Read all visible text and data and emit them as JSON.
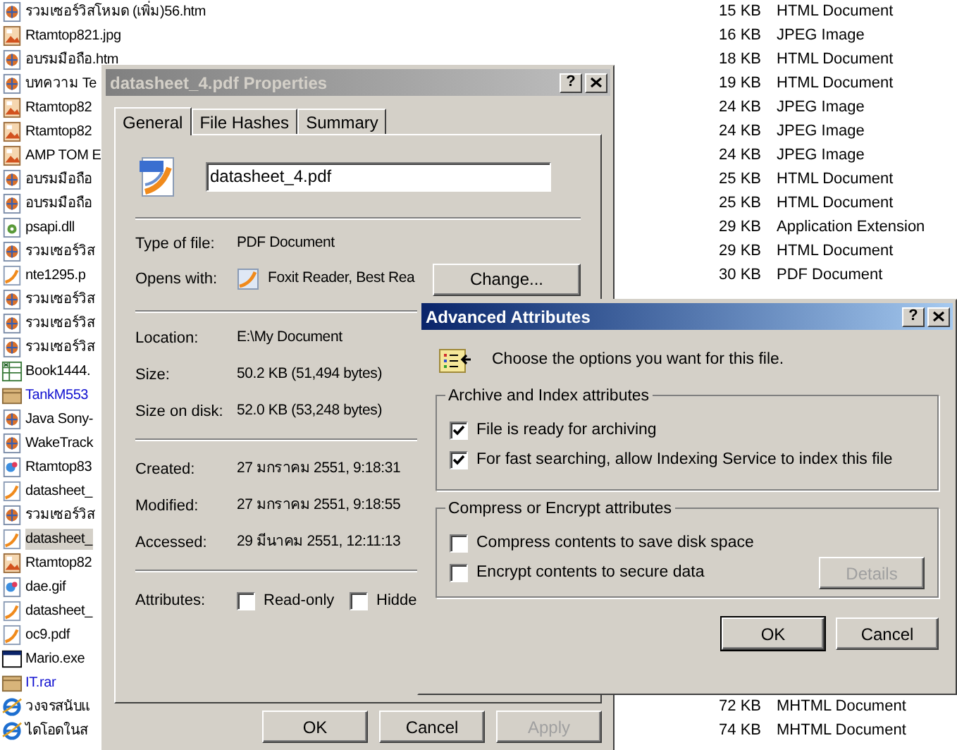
{
  "file_list": {
    "rows": [
      {
        "name": "รวมเซอร์วิสโหมด (เพิ่ม)56.htm",
        "kind": "htm",
        "selected": false,
        "compressed": false,
        "size": "15 KB",
        "type": "HTML Document"
      },
      {
        "name": "Rtamtop821.jpg",
        "kind": "jpg",
        "selected": false,
        "compressed": false,
        "size": "16 KB",
        "type": "JPEG Image"
      },
      {
        "name": "อบรมมือถือ.htm",
        "kind": "htm",
        "selected": false,
        "compressed": false,
        "size": "18 KB",
        "type": "HTML Document"
      },
      {
        "name": "บทความ Te",
        "kind": "htm",
        "selected": false,
        "compressed": false,
        "size": "19 KB",
        "type": "HTML Document"
      },
      {
        "name": "Rtamtop82",
        "kind": "jpg",
        "selected": false,
        "compressed": false,
        "size": "24 KB",
        "type": "JPEG Image"
      },
      {
        "name": "Rtamtop82",
        "kind": "jpg",
        "selected": false,
        "compressed": false,
        "size": "24 KB",
        "type": "JPEG Image"
      },
      {
        "name": "AMP TOM E",
        "kind": "jpg",
        "selected": false,
        "compressed": false,
        "size": "24 KB",
        "type": "JPEG Image"
      },
      {
        "name": "อบรมมือถือ",
        "kind": "htm",
        "selected": false,
        "compressed": false,
        "size": "25 KB",
        "type": "HTML Document"
      },
      {
        "name": "อบรมมือถือ",
        "kind": "htm",
        "selected": false,
        "compressed": false,
        "size": "25 KB",
        "type": "HTML Document"
      },
      {
        "name": "psapi.dll",
        "kind": "dll",
        "selected": false,
        "compressed": false,
        "size": "29 KB",
        "type": "Application Extension"
      },
      {
        "name": "รวมเซอร์วิส",
        "kind": "htm",
        "selected": false,
        "compressed": false,
        "size": "29 KB",
        "type": "HTML Document"
      },
      {
        "name": "nte1295.p",
        "kind": "pdf",
        "selected": false,
        "compressed": false,
        "size": "30 KB",
        "type": "PDF Document"
      },
      {
        "name": "รวมเซอร์วิส",
        "kind": "htm",
        "selected": false,
        "compressed": false
      },
      {
        "name": "รวมเซอร์วิส",
        "kind": "htm",
        "selected": false,
        "compressed": false
      },
      {
        "name": "รวมเซอร์วิส",
        "kind": "htm",
        "selected": false,
        "compressed": false
      },
      {
        "name": "Book1444.",
        "kind": "xls",
        "selected": false,
        "compressed": false
      },
      {
        "name": "TankM553",
        "kind": "rar",
        "selected": false,
        "compressed": true
      },
      {
        "name": "Java Sony-",
        "kind": "htm",
        "selected": false,
        "compressed": false
      },
      {
        "name": "WakeTrack",
        "kind": "htm",
        "selected": false,
        "compressed": false
      },
      {
        "name": "Rtamtop83",
        "kind": "gif",
        "selected": false,
        "compressed": false
      },
      {
        "name": "datasheet_",
        "kind": "pdf",
        "selected": false,
        "compressed": false
      },
      {
        "name": "รวมเซอร์วิส",
        "kind": "htm",
        "selected": false,
        "compressed": false
      },
      {
        "name": "datasheet_",
        "kind": "pdf",
        "selected": true,
        "compressed": false
      },
      {
        "name": "Rtamtop82",
        "kind": "jpg",
        "selected": false,
        "compressed": false
      },
      {
        "name": "dae.gif",
        "kind": "gif",
        "selected": false,
        "compressed": false
      },
      {
        "name": "datasheet_",
        "kind": "pdf",
        "selected": false,
        "compressed": false
      },
      {
        "name": "oc9.pdf",
        "kind": "pdf",
        "selected": false,
        "compressed": false
      },
      {
        "name": "Mario.exe",
        "kind": "exe",
        "selected": false,
        "compressed": false
      },
      {
        "name": "IT.rar",
        "kind": "rar",
        "selected": false,
        "compressed": true
      },
      {
        "name": "วงจรสนับแ",
        "kind": "mht",
        "selected": false,
        "compressed": false,
        "size": "72 KB",
        "type": "MHTML Document"
      },
      {
        "name": "ไดโอดในส",
        "kind": "mht",
        "selected": false,
        "compressed": false,
        "size": "74 KB",
        "type": "MHTML Document"
      }
    ]
  },
  "properties_dialog": {
    "title": "datasheet_4.pdf Properties",
    "active": false,
    "help": "?",
    "tabs": [
      {
        "label": "General",
        "selected": true
      },
      {
        "label": "File Hashes",
        "selected": false
      },
      {
        "label": "Summary",
        "selected": false
      }
    ],
    "file_name": "datasheet_4.pdf",
    "type_of_file": {
      "label": "Type of file:",
      "value": "PDF Document"
    },
    "opens_with": {
      "label": "Opens with:",
      "value": "Foxit Reader, Best Rea",
      "button": "Change..."
    },
    "location": {
      "label": "Location:",
      "value": "E:\\My Document"
    },
    "size": {
      "label": "Size:",
      "value": "50.2 KB (51,494 bytes)"
    },
    "size_on_disk": {
      "label": "Size on disk:",
      "value": "52.0 KB (53,248 bytes)"
    },
    "created": {
      "label": "Created:",
      "value": "27 มกราคม 2551, 9:18:31"
    },
    "modified": {
      "label": "Modified:",
      "value": "27 มกราคม 2551, 9:18:55"
    },
    "accessed": {
      "label": "Accessed:",
      "value": "29 มีนาคม 2551, 12:11:13"
    },
    "attributes": {
      "label": "Attributes:",
      "options": [
        {
          "label": "Read-only",
          "checked": false
        },
        {
          "label": "Hidde",
          "checked": false
        }
      ]
    },
    "buttons": [
      {
        "label": "OK",
        "disabled": false
      },
      {
        "label": "Cancel",
        "disabled": false
      },
      {
        "label": "Apply",
        "disabled": true
      }
    ]
  },
  "advanced_dialog": {
    "title": "Advanced Attributes",
    "active": true,
    "help": "?",
    "intro": "Choose the options you want for this file.",
    "groups": [
      {
        "title": "Archive and Index attributes",
        "options": [
          {
            "label": "File is ready for archiving",
            "checked": true
          },
          {
            "label": "For fast searching, allow Indexing Service to index this file",
            "checked": true
          }
        ]
      },
      {
        "title": "Compress or Encrypt attributes",
        "options": [
          {
            "label": "Compress contents to save disk space",
            "checked": false
          },
          {
            "label": "Encrypt contents to secure data",
            "checked": false
          }
        ],
        "button": {
          "label": "Details",
          "disabled": true
        }
      }
    ],
    "buttons": [
      {
        "label": "OK",
        "default": true
      },
      {
        "label": "Cancel",
        "default": false
      }
    ]
  }
}
